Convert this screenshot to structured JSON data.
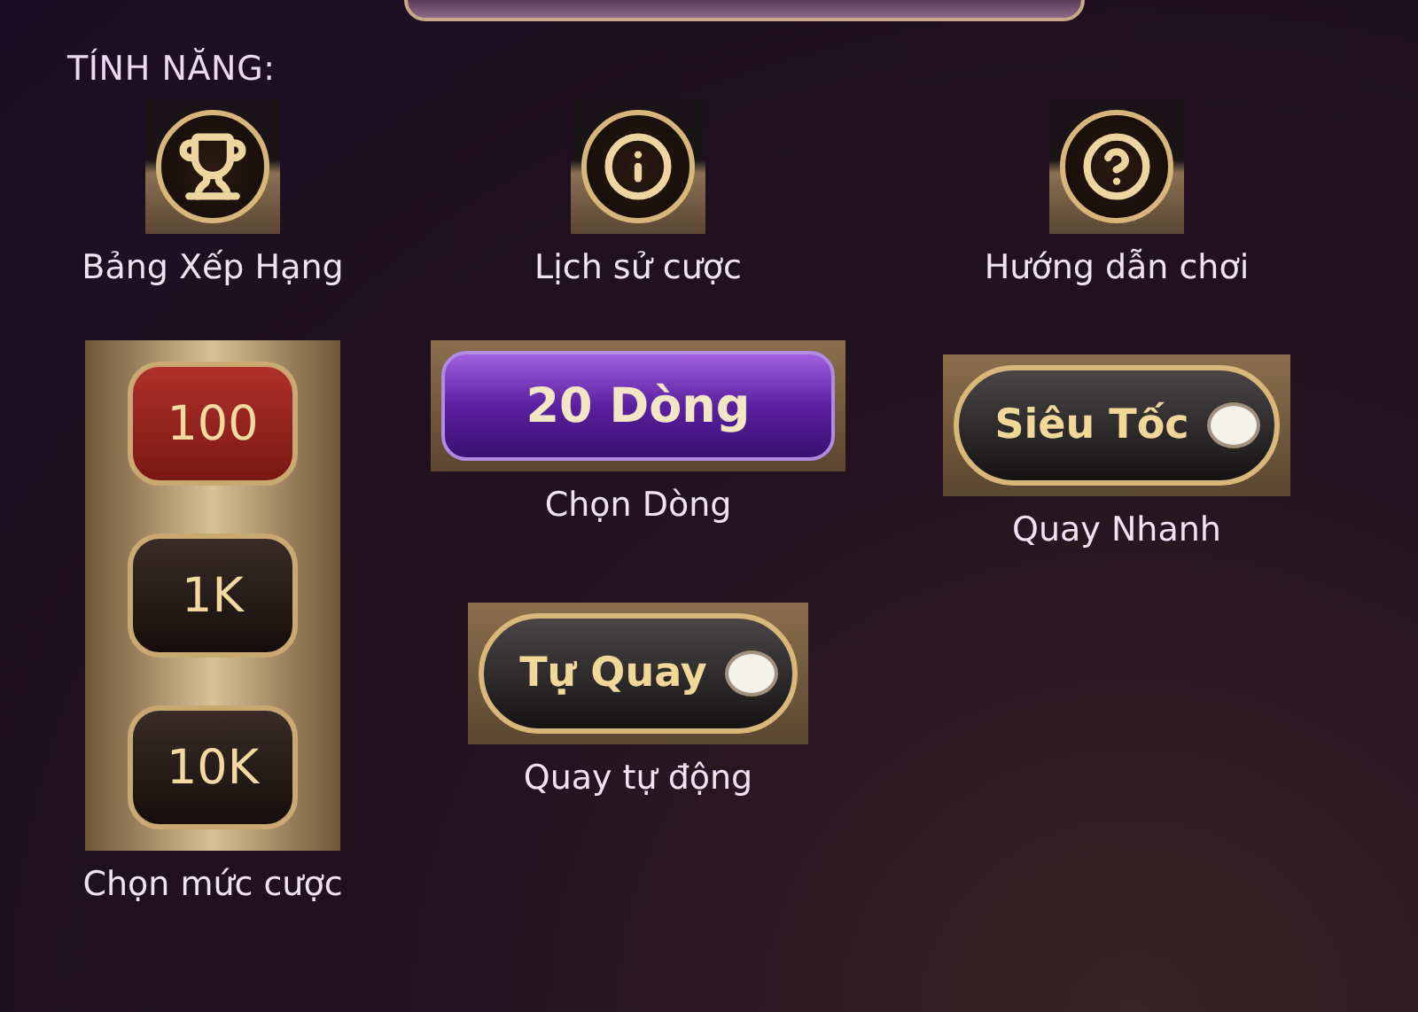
{
  "section_title": "TÍNH NĂNG:",
  "features": [
    {
      "kind": "trophy",
      "label": "Bảng Xếp Hạng"
    },
    {
      "kind": "info",
      "label": "Lịch sử cược"
    },
    {
      "kind": "help",
      "label": "Hướng dẫn chơi"
    }
  ],
  "bet": {
    "label": "Chọn mức cược",
    "options": [
      {
        "text": "100",
        "selected": true
      },
      {
        "text": "1K",
        "selected": false
      },
      {
        "text": "10K",
        "selected": false
      }
    ]
  },
  "lines": {
    "value": "20 Dòng",
    "label": "Chọn Dòng"
  },
  "turbo": {
    "text": "Siêu Tốc",
    "on": false,
    "label": "Quay Nhanh"
  },
  "auto": {
    "text": "Tự Quay",
    "on": false,
    "label": "Quay tự động"
  }
}
